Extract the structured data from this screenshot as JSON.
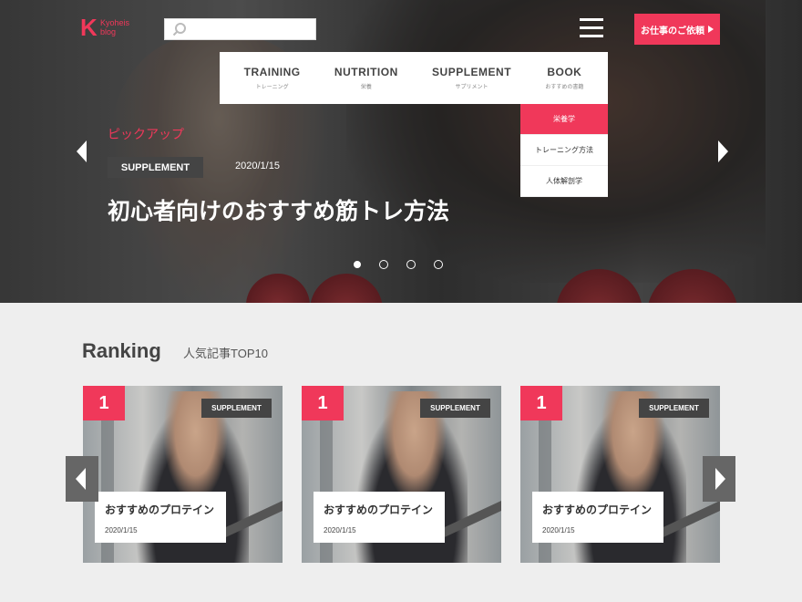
{
  "header": {
    "logo_letter": "K",
    "logo_text": "Kyoheis blog",
    "search": {
      "placeholder": ""
    },
    "cta_label": "お仕事のご依頼"
  },
  "nav": [
    {
      "en": "TRAINING",
      "ja": "トレーニング"
    },
    {
      "en": "NUTRITION",
      "ja": "栄養"
    },
    {
      "en": "SUPPLEMENT",
      "ja": "サプリメント"
    },
    {
      "en": "BOOK",
      "ja": "おすすめの書籍"
    }
  ],
  "dropdown": [
    {
      "label": "栄養学",
      "active": true
    },
    {
      "label": "トレーニング方法",
      "active": false
    },
    {
      "label": "人体解剖学",
      "active": false
    }
  ],
  "hero": {
    "pickup": "ピックアップ",
    "category": "SUPPLEMENT",
    "date": "2020/1/15",
    "title": "初心者向けのおすすめ筋トレ方法",
    "slides": 4,
    "current_slide": 1
  },
  "ranking": {
    "title": "Ranking",
    "subtitle": "人気記事TOP10",
    "cards": [
      {
        "rank": "1",
        "category": "SUPPLEMENT",
        "title": "おすすめのプロテイン",
        "date": "2020/1/15"
      },
      {
        "rank": "1",
        "category": "SUPPLEMENT",
        "title": "おすすめのプロテイン",
        "date": "2020/1/15"
      },
      {
        "rank": "1",
        "category": "SUPPLEMENT",
        "title": "おすすめのプロテイン",
        "date": "2020/1/15"
      }
    ]
  },
  "colors": {
    "accent": "#f0385a",
    "tag_bg": "#444444",
    "page_bg": "#eeeeee"
  }
}
